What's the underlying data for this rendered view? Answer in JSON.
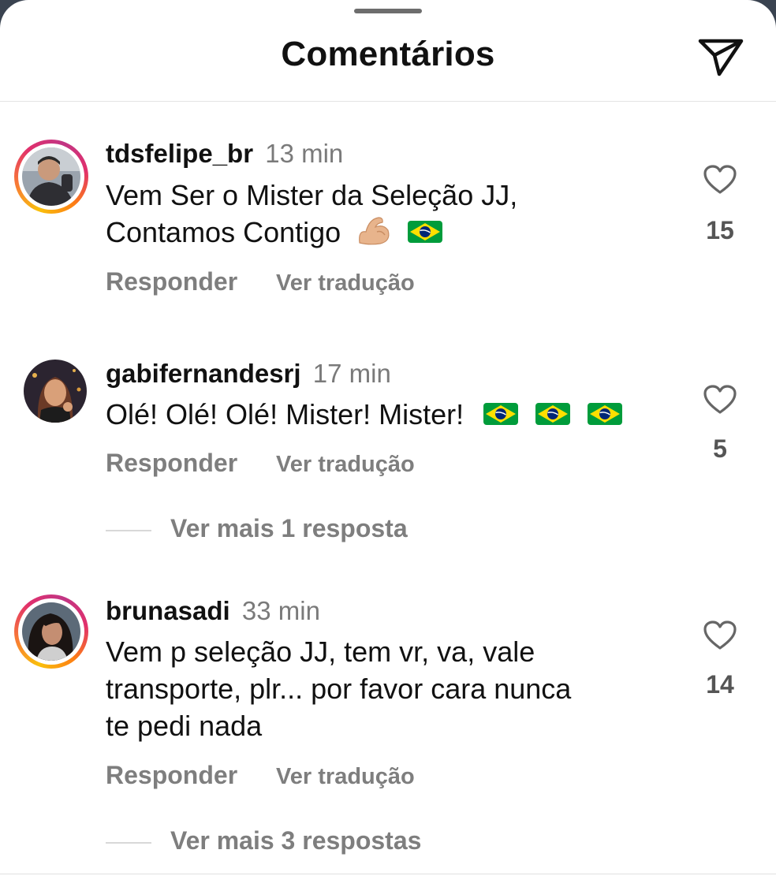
{
  "header": {
    "title": "Comentários"
  },
  "comments": [
    {
      "username": "tdsfelipe_br",
      "time": "13 min",
      "line1": "Vem Ser o Mister da Seleção JJ,",
      "line2": "Contamos Contigo",
      "likes": "15",
      "reply": "Responder",
      "translate": "Ver tradução"
    },
    {
      "username": "gabifernandesrj",
      "time": "17 min",
      "line1": "Olé! Olé! Olé! Mister! Mister!",
      "likes": "5",
      "reply": "Responder",
      "translate": "Ver tradução",
      "more_replies": "Ver mais 1 resposta"
    },
    {
      "username": "brunasadi",
      "time": "33 min",
      "line1": "Vem p seleção JJ, tem vr, va, vale",
      "line2": "transporte, plr... por favor cara nunca",
      "line3": "te pedi nada",
      "likes": "14",
      "reply": "Responder",
      "translate": "Ver tradução",
      "more_replies": "Ver mais 3 respostas"
    }
  ],
  "icons": {
    "send": "paper-plane-icon",
    "like": "heart-icon",
    "flag": "brazil-flag-emoji",
    "muscle": "flexed-biceps-emoji"
  },
  "colors": {
    "story_ring_start": "#f9c00c",
    "story_ring_end": "#c13584",
    "muted_text": "#7e7e7e",
    "flag_green": "#009c3b",
    "flag_yellow": "#ffdf00",
    "flag_blue": "#002776"
  }
}
